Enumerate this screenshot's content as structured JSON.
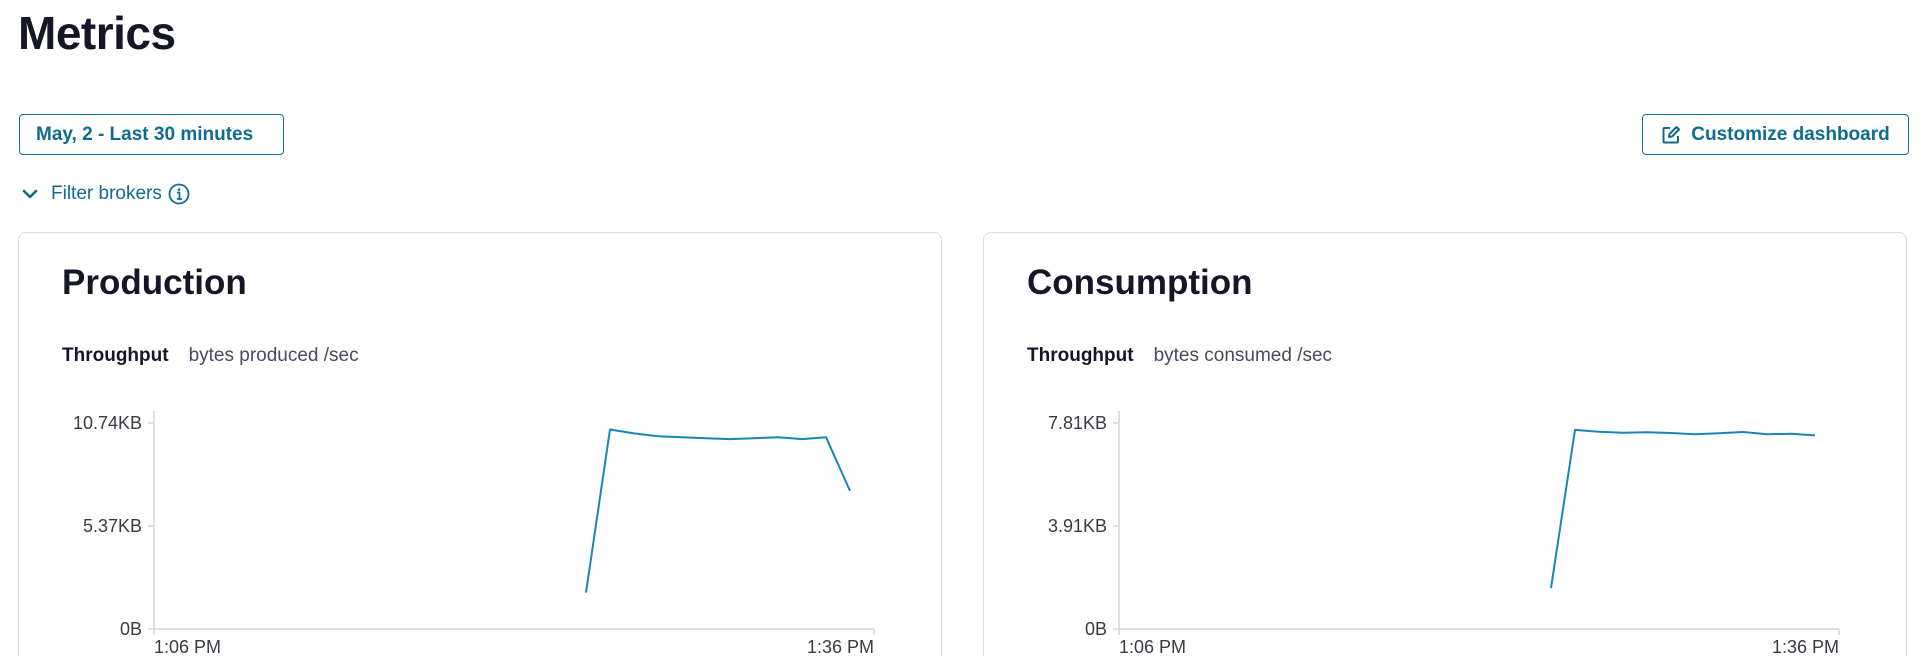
{
  "page": {
    "title": "Metrics"
  },
  "toolbar": {
    "range_label": "May, 2 - Last 30 minutes",
    "customize_label": "Customize dashboard",
    "customize_icon": "edit-icon"
  },
  "filter": {
    "label": "Filter brokers",
    "expand_icon": "chevron-down-icon",
    "info_icon": "info-icon"
  },
  "colors": {
    "accent": "#0f6c8f",
    "line": "#1a86b3",
    "axis": "#d5d6db"
  },
  "cards": [
    {
      "title": "Production",
      "metric_label": "Throughput",
      "metric_unit": "bytes produced /sec"
    },
    {
      "title": "Consumption",
      "metric_label": "Throughput",
      "metric_unit": "bytes consumed /sec"
    }
  ],
  "chart_data": [
    {
      "type": "line",
      "title": "Production",
      "ylabel": "bytes produced /sec",
      "x_tick_labels": [
        "1:06 PM",
        "1:36 PM"
      ],
      "y_tick_labels": [
        "10.74KB",
        "5.37KB",
        "0B"
      ],
      "y_ticks": [
        10.74,
        5.37,
        0
      ],
      "ylim": [
        0,
        10.74
      ],
      "xlim": [
        0,
        30
      ],
      "series": [
        {
          "x": [
            18,
            19,
            20,
            21,
            22,
            23,
            24,
            25,
            26,
            27,
            28,
            29
          ],
          "y": [
            1.9,
            10.4,
            10.2,
            10.05,
            10.0,
            9.95,
            9.9,
            9.95,
            10.0,
            9.9,
            10.0,
            7.2
          ]
        }
      ]
    },
    {
      "type": "line",
      "title": "Consumption",
      "ylabel": "bytes consumed /sec",
      "x_tick_labels": [
        "1:06 PM",
        "1:36 PM"
      ],
      "y_tick_labels": [
        "7.81KB",
        "3.91KB",
        "0B"
      ],
      "y_ticks": [
        7.81,
        3.91,
        0
      ],
      "ylim": [
        0,
        7.81
      ],
      "xlim": [
        0,
        30
      ],
      "series": [
        {
          "x": [
            18,
            19,
            20,
            21,
            22,
            23,
            24,
            25,
            26,
            27,
            28,
            29
          ],
          "y": [
            1.55,
            7.55,
            7.48,
            7.44,
            7.46,
            7.43,
            7.38,
            7.42,
            7.47,
            7.38,
            7.4,
            7.34
          ]
        }
      ]
    }
  ]
}
